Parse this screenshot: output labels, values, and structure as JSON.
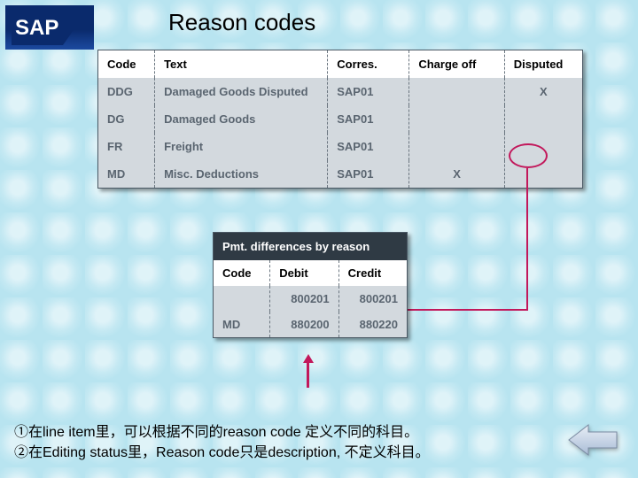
{
  "title": "Reason codes",
  "logo_text": "SAP",
  "main_table": {
    "headers": {
      "code": "Code",
      "text": "Text",
      "corres": "Corres.",
      "charge": "Charge off",
      "disputed": "Disputed"
    },
    "rows": [
      {
        "code": "DDG",
        "text": "Damaged Goods Disputed",
        "corres": "SAP01",
        "charge": "",
        "disputed": "X"
      },
      {
        "code": "DG",
        "text": "Damaged Goods",
        "corres": "SAP01",
        "charge": "",
        "disputed": ""
      },
      {
        "code": "FR",
        "text": "Freight",
        "corres": "SAP01",
        "charge": "",
        "disputed": ""
      },
      {
        "code": "MD",
        "text": "Misc. Deductions",
        "corres": "SAP01",
        "charge": "X",
        "disputed": ""
      }
    ]
  },
  "sub_table": {
    "title": "Pmt. differences by reason",
    "headers": {
      "code": "Code",
      "debit": "Debit",
      "credit": "Credit"
    },
    "rows": [
      {
        "code": "",
        "debit": "800201",
        "credit": "800201"
      },
      {
        "code": "MD",
        "debit": "880200",
        "credit": "880220"
      }
    ]
  },
  "footer": {
    "line1": "①在line item里，可以根据不同的reason code 定义不同的科目。",
    "line2": "②在Editing status里，Reason code只是description, 不定义科目。"
  },
  "annot_color": "#c2185b"
}
